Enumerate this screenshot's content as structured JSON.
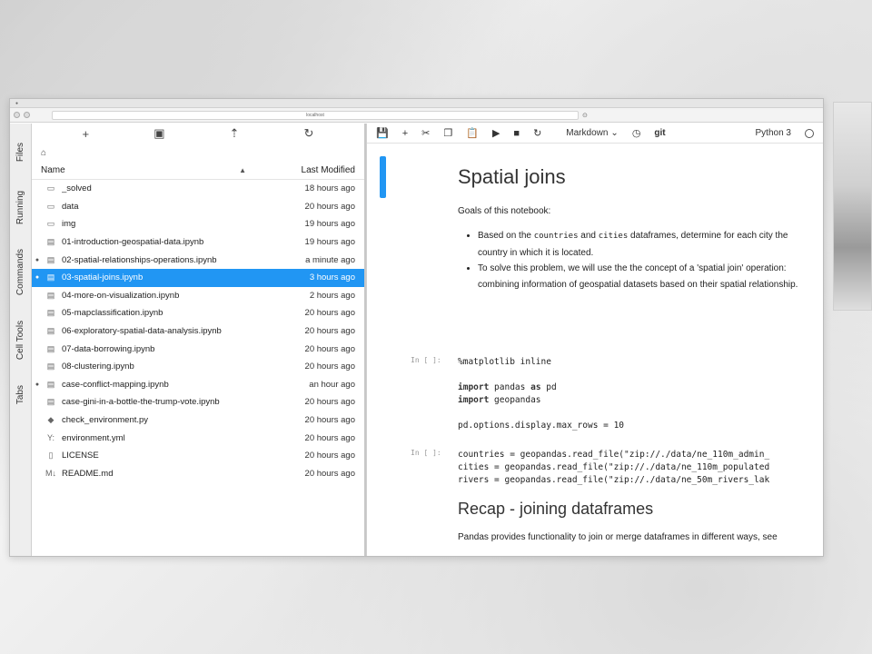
{
  "browser": {
    "url": "localhost"
  },
  "side_tabs": [
    "Files",
    "Running",
    "Commands",
    "Cell Tools",
    "Tabs"
  ],
  "file_browser": {
    "header": {
      "name": "Name",
      "modified": "Last Modified"
    },
    "files": [
      {
        "name": "_solved",
        "modified": "18 hours ago",
        "icon": "folder-icon",
        "running": false,
        "selected": false
      },
      {
        "name": "data",
        "modified": "20 hours ago",
        "icon": "folder-icon",
        "running": false,
        "selected": false
      },
      {
        "name": "img",
        "modified": "19 hours ago",
        "icon": "folder-icon",
        "running": false,
        "selected": false
      },
      {
        "name": "01-introduction-geospatial-data.ipynb",
        "modified": "19 hours ago",
        "icon": "notebook-icon",
        "running": false,
        "selected": false
      },
      {
        "name": "02-spatial-relationships-operations.ipynb",
        "modified": "a minute ago",
        "icon": "notebook-icon",
        "running": true,
        "selected": false
      },
      {
        "name": "03-spatial-joins.ipynb",
        "modified": "3 hours ago",
        "icon": "notebook-icon",
        "running": true,
        "selected": true
      },
      {
        "name": "04-more-on-visualization.ipynb",
        "modified": "2 hours ago",
        "icon": "notebook-icon",
        "running": false,
        "selected": false
      },
      {
        "name": "05-mapclassification.ipynb",
        "modified": "20 hours ago",
        "icon": "notebook-icon",
        "running": false,
        "selected": false
      },
      {
        "name": "06-exploratory-spatial-data-analysis.ipynb",
        "modified": "20 hours ago",
        "icon": "notebook-icon",
        "running": false,
        "selected": false
      },
      {
        "name": "07-data-borrowing.ipynb",
        "modified": "20 hours ago",
        "icon": "notebook-icon",
        "running": false,
        "selected": false
      },
      {
        "name": "08-clustering.ipynb",
        "modified": "20 hours ago",
        "icon": "notebook-icon",
        "running": false,
        "selected": false
      },
      {
        "name": "case-conflict-mapping.ipynb",
        "modified": "an hour ago",
        "icon": "notebook-icon",
        "running": true,
        "selected": false
      },
      {
        "name": "case-gini-in-a-bottle-the-trump-vote.ipynb",
        "modified": "20 hours ago",
        "icon": "notebook-icon",
        "running": false,
        "selected": false
      },
      {
        "name": "check_environment.py",
        "modified": "20 hours ago",
        "icon": "python-icon",
        "running": false,
        "selected": false
      },
      {
        "name": "environment.yml",
        "modified": "20 hours ago",
        "icon": "yaml-icon",
        "running": false,
        "selected": false
      },
      {
        "name": "LICENSE",
        "modified": "20 hours ago",
        "icon": "file-icon",
        "running": false,
        "selected": false
      },
      {
        "name": "README.md",
        "modified": "20 hours ago",
        "icon": "markdown-icon",
        "running": false,
        "selected": false
      }
    ]
  },
  "notebook": {
    "cell_type": "Markdown",
    "kernel": "Python 3",
    "git_label": "git",
    "title": "Spatial joins",
    "goals_intro": "Goals of this notebook:",
    "bullet1": {
      "pre": "Based on the ",
      "code1": "countries",
      "mid": " and ",
      "code2": "cities",
      "post": " dataframes, determine for each city the country in which it is located."
    },
    "bullet2": "To solve this problem, we will use the the concept of a 'spatial join' operation: combining information of geospatial datasets based on their spatial relationship.",
    "prompt1": "In [ ]:",
    "prompt2": "In [ ]:",
    "code1": {
      "line1": "%matplotlib inline",
      "kw_import": "import",
      "line3_rest": " pandas ",
      "kw_as": "as",
      "line3_tail": " pd",
      "line4_rest": " geopandas",
      "line6": "pd.options.display.max_rows = 10"
    },
    "code2": {
      "line1": "countries = geopandas.read_file(\"zip://./data/ne_110m_admin_",
      "line2": "cities = geopandas.read_file(\"zip://./data/ne_110m_populated",
      "line3": "rivers = geopandas.read_file(\"zip://./data/ne_50m_rivers_lak"
    },
    "recap_title": "Recap - joining dataframes",
    "recap_text": "Pandas provides functionality to join or merge dataframes in different ways, see"
  }
}
